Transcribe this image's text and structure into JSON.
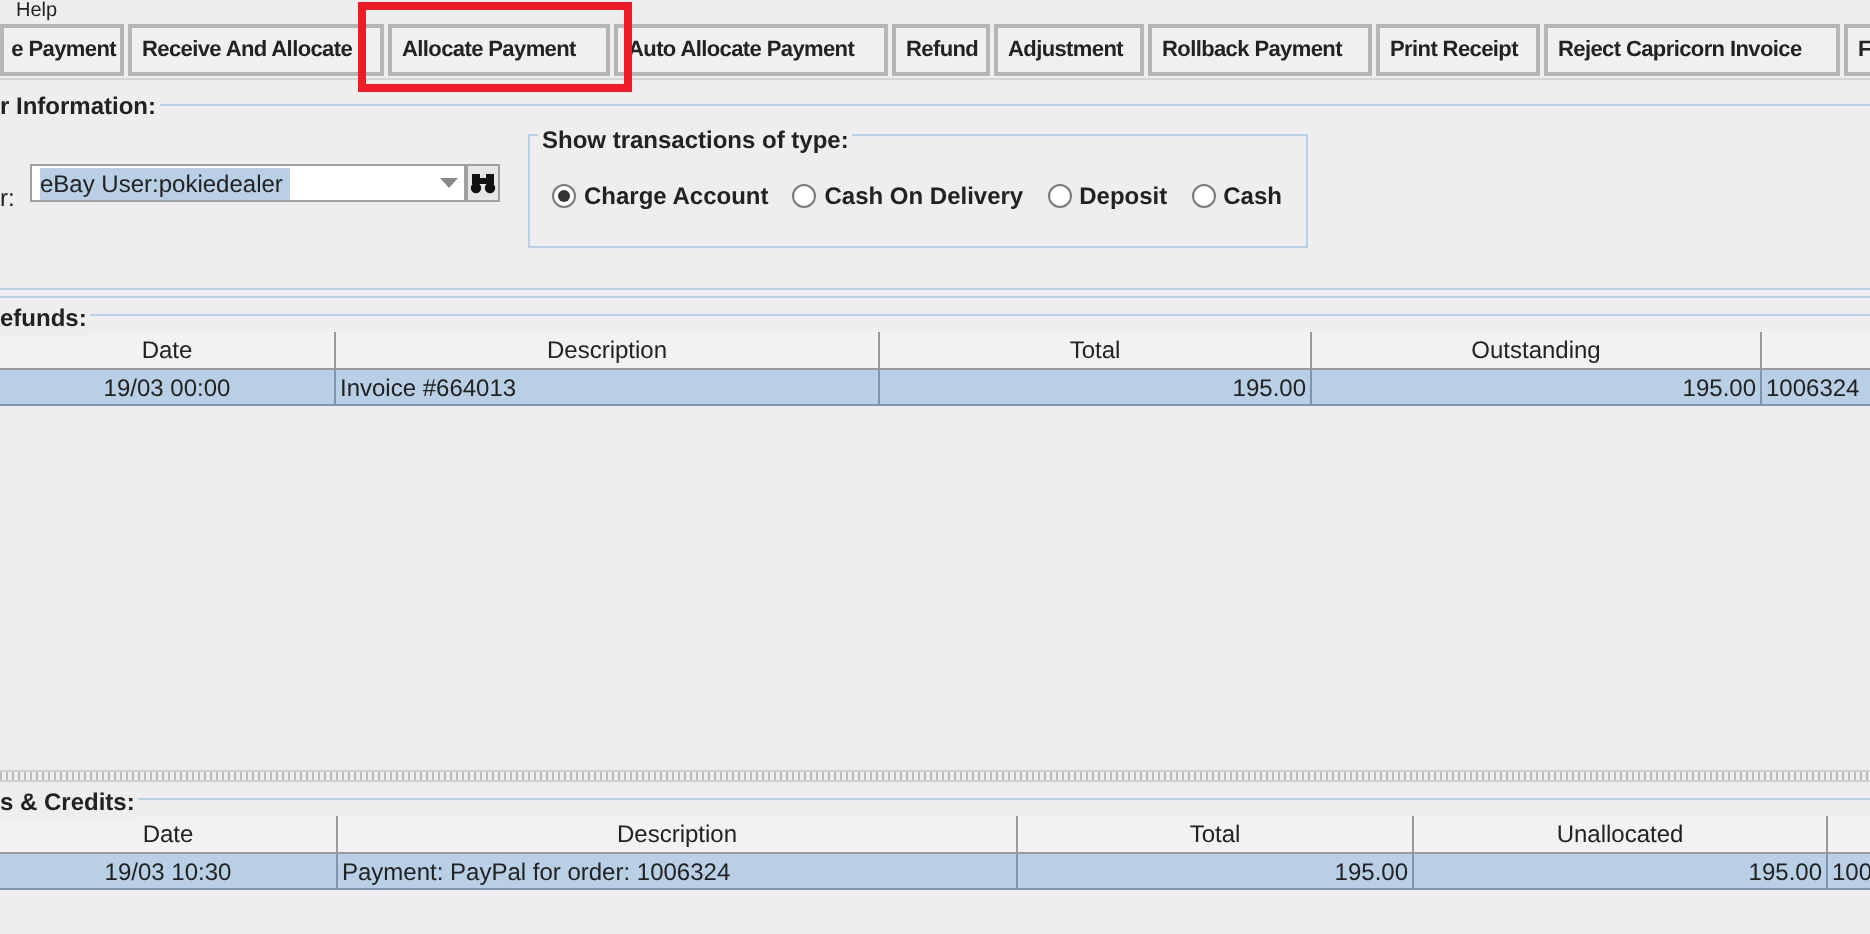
{
  "menu": [
    "Help"
  ],
  "toolbar": [
    {
      "label": "e Payment",
      "highlighted": false
    },
    {
      "label": "Receive And Allocate",
      "highlighted": false
    },
    {
      "label": "Allocate Payment",
      "highlighted": true
    },
    {
      "label": "Auto Allocate Payment",
      "highlighted": false
    },
    {
      "label": "Refund",
      "highlighted": false
    },
    {
      "label": "Adjustment",
      "highlighted": false
    },
    {
      "label": "Rollback Payment",
      "highlighted": false
    },
    {
      "label": "Print Receipt",
      "highlighted": false
    },
    {
      "label": "Reject Capricorn Invoice",
      "highlighted": false
    },
    {
      "label": "F",
      "highlighted": false
    }
  ],
  "info": {
    "title": "r Information:",
    "field_label": "r:",
    "customer": "eBay User:pokiedealer",
    "filter": {
      "title": "Show transactions of type:",
      "options": [
        {
          "label": "Charge Account",
          "selected": true
        },
        {
          "label": "Cash On Delivery",
          "selected": false
        },
        {
          "label": "Deposit",
          "selected": false
        },
        {
          "label": "Cash",
          "selected": false
        }
      ]
    }
  },
  "invoices": {
    "title": "efunds:",
    "columns": [
      "Date",
      "Description",
      "Total",
      "Outstanding"
    ],
    "rows": [
      {
        "selected": true,
        "cells": [
          "19/03 00:00",
          "Invoice #664013",
          "195.00",
          "195.00",
          "1006324"
        ]
      }
    ]
  },
  "payments": {
    "title": "s & Credits:",
    "columns": [
      "Date",
      "Description",
      "Total",
      "Unallocated"
    ],
    "rows": [
      {
        "selected": true,
        "cells": [
          "19/03 10:30",
          "Payment: PayPal for order: 1006324",
          "195.00",
          "195.00",
          "100"
        ]
      }
    ]
  }
}
